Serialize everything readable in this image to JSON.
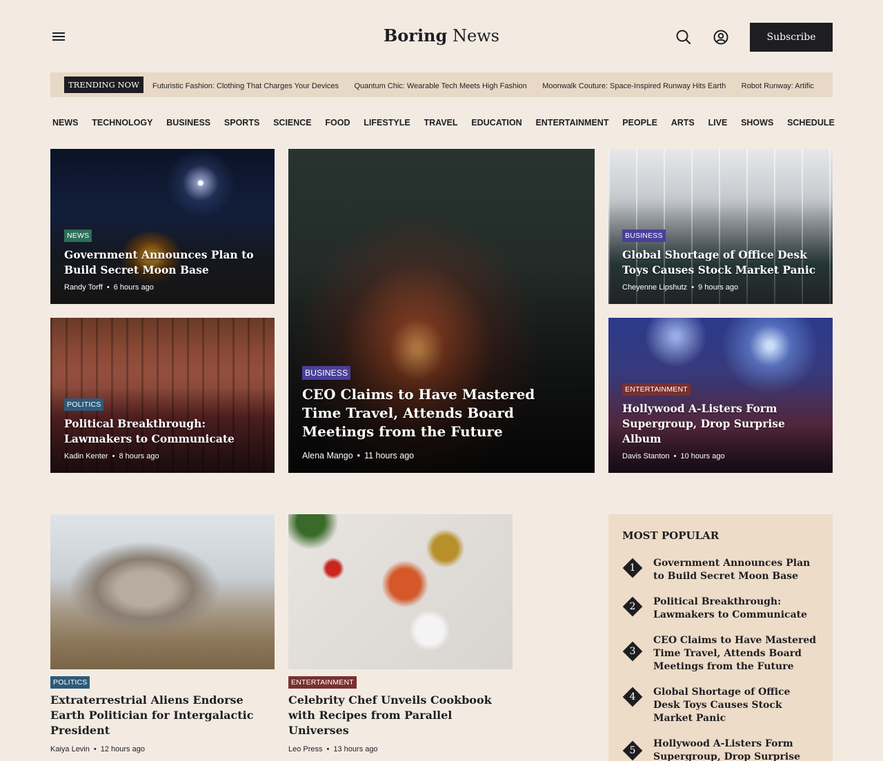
{
  "header": {
    "logo_bold": "Boring",
    "logo_light": "News",
    "subscribe_label": "Subscribe"
  },
  "icons": {
    "menu": "menu-icon",
    "search": "search-icon",
    "account": "user-circle-icon"
  },
  "trending": {
    "label": "TRENDING NOW",
    "items": [
      "Futuristic Fashion: Clothing That Charges Your Devices",
      "Quantum Chic: Wearable Tech Meets High Fashion",
      "Moonwalk Couture: Space-Inspired Runway Hits Earth",
      "Robot Runway: Artific"
    ]
  },
  "nav": [
    "NEWS",
    "TECHNOLOGY",
    "BUSINESS",
    "SPORTS",
    "SCIENCE",
    "FOOD",
    "LIFESTYLE",
    "TRAVEL",
    "EDUCATION",
    "ENTERTAINMENT",
    "PEOPLE",
    "ARTS",
    "LIVE",
    "SHOWS",
    "SCHEDULE"
  ],
  "featured": [
    {
      "tag": "NEWS",
      "title": "Government Announces Plan to Build Secret Moon Base",
      "author": "Randy Torff",
      "time": "6 hours ago"
    },
    {
      "tag": "POLITICS",
      "title": "Political Breakthrough: Lawmakers to Communicate",
      "author": "Kadin Kenter",
      "time": "8 hours ago"
    },
    {
      "tag": "BUSINESS",
      "title": "CEO Claims to Have Mastered Time Travel, Attends Board Meetings from the Future",
      "author": "Alena Mango",
      "time": "11 hours ago"
    },
    {
      "tag": "BUSINESS",
      "title": "Global Shortage of Office Desk Toys Causes Stock Market Panic",
      "author": "Cheyenne Lipshutz",
      "time": "9 hours ago"
    },
    {
      "tag": "ENTERTAINMENT",
      "title": "Hollywood A-Listers Form Supergroup, Drop Surprise Album",
      "author": "Davis Stanton",
      "time": "10 hours ago"
    }
  ],
  "stories": [
    {
      "tag": "POLITICS",
      "title": "Extraterrestrial Aliens Endorse Earth Politician for Intergalactic President",
      "author": "Kaiya Levin",
      "time": "12 hours ago"
    },
    {
      "tag": "ENTERTAINMENT",
      "title": "Celebrity Chef Unveils Cookbook with Recipes from Parallel Universes",
      "author": "Leo Press",
      "time": "13 hours ago"
    }
  ],
  "popular": {
    "heading": "MOST POPULAR",
    "items": [
      {
        "num": "1",
        "title": "Government Announces Plan to Build Secret Moon Base"
      },
      {
        "num": "2",
        "title": "Political Breakthrough: Lawmakers to Communicate"
      },
      {
        "num": "3",
        "title": "CEO Claims to Have Mastered Time Travel, Attends Board Meetings from the Future"
      },
      {
        "num": "4",
        "title": "Global Shortage of Office Desk Toys Causes Stock Market Panic"
      },
      {
        "num": "5",
        "title": "Hollywood A-Listers Form Supergroup, Drop Surprise Album"
      }
    ]
  },
  "colors": {
    "background": "#f3ebe2",
    "ink": "#1e1e22",
    "trending_bg": "#e8d9c6",
    "popular_bg": "#ecdcc8"
  }
}
